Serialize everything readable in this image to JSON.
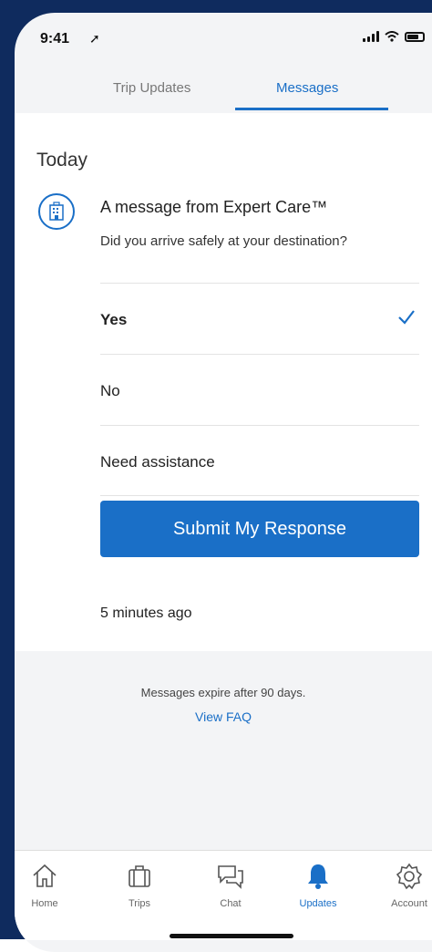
{
  "status_bar": {
    "time": "9:41",
    "location_symbol": "➚"
  },
  "tabs": [
    {
      "label": "Trip Updates"
    },
    {
      "label": "Messages"
    }
  ],
  "main": {
    "section_title": "Today",
    "message_title": "A message from Expert Care™",
    "question": "Did you arrive safely at your destination?",
    "options": [
      {
        "label": "Yes",
        "selected": true
      },
      {
        "label": "No"
      },
      {
        "label": "Need assistance"
      }
    ],
    "submit_label": "Submit My Response",
    "timestamp": "5 minutes ago"
  },
  "info": {
    "expire_text": "Messages expire after 90 days.",
    "faq_link": "View FAQ"
  },
  "bottom_nav": [
    {
      "label": "Home",
      "icon": "home-icon"
    },
    {
      "label": "Trips",
      "icon": "suitcase-icon"
    },
    {
      "label": "Chat",
      "icon": "chat-icon"
    },
    {
      "label": "Updates",
      "icon": "bell-icon"
    },
    {
      "label": "Account",
      "icon": "gear-icon"
    }
  ],
  "colors": {
    "accent": "#1a6fc7",
    "frame": "#0f2b5e"
  }
}
